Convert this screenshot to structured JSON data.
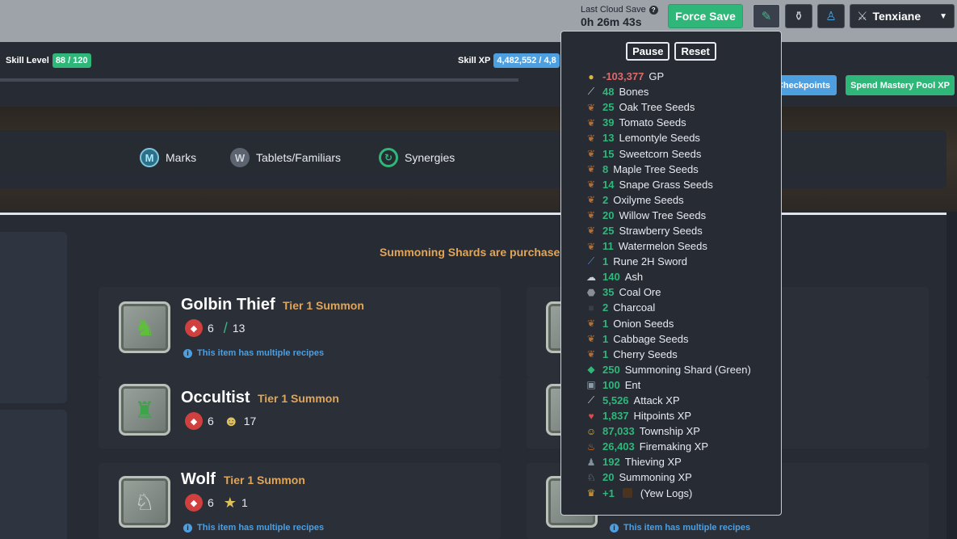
{
  "header": {
    "cloud_label": "Last Cloud Save",
    "cloud_time": "0h 26m 43s",
    "force_save": "Force Save",
    "character": "Tenxiane"
  },
  "skillbar": {
    "level_label": "Skill Level",
    "level_value": "88 / 120",
    "xp_label": "Skill XP",
    "xp_value": "4,482,552 / 4,8",
    "checkpoints": "Checkpoints",
    "spend_pool": "Spend Mastery Pool XP"
  },
  "tabs": [
    {
      "label": "Marks",
      "icon": "marks-icon"
    },
    {
      "label": "Tablets/Familiars",
      "icon": "wolf-icon"
    },
    {
      "label": "Synergies",
      "icon": "synergy-icon"
    }
  ],
  "notice": "Summoning Shards are purchase",
  "cards": [
    {
      "name": "Golbin Thief",
      "tier": "Tier 1 Summon",
      "shards": "6",
      "cost2": "13",
      "recipe": "This item has multiple recipes"
    },
    {
      "name": "Occultist",
      "tier": "Tier 1 Summon",
      "shards": "6",
      "cost2": "17"
    },
    {
      "name": "Wolf",
      "tier": "Tier 1 Summon",
      "shards": "6",
      "cost2": "1",
      "recipe": "This item has multiple recipes"
    }
  ],
  "right_recipe": "This item has multiple recipes",
  "popup": {
    "pause": "Pause",
    "reset": "Reset",
    "loot": [
      {
        "qty": "-103,377",
        "name": "GP",
        "icon": "coins-icon",
        "negative": true
      },
      {
        "qty": "48",
        "name": "Bones",
        "icon": "bones-icon"
      },
      {
        "qty": "25",
        "name": "Oak Tree Seeds",
        "icon": "seed-icon"
      },
      {
        "qty": "39",
        "name": "Tomato Seeds",
        "icon": "seed-icon"
      },
      {
        "qty": "13",
        "name": "Lemontyle Seeds",
        "icon": "seed-icon"
      },
      {
        "qty": "15",
        "name": "Sweetcorn Seeds",
        "icon": "seed-icon"
      },
      {
        "qty": "8",
        "name": "Maple Tree Seeds",
        "icon": "seed-icon"
      },
      {
        "qty": "14",
        "name": "Snape Grass Seeds",
        "icon": "seed-icon"
      },
      {
        "qty": "2",
        "name": "Oxilyme Seeds",
        "icon": "seed-icon"
      },
      {
        "qty": "20",
        "name": "Willow Tree Seeds",
        "icon": "seed-icon"
      },
      {
        "qty": "25",
        "name": "Strawberry Seeds",
        "icon": "seed-icon"
      },
      {
        "qty": "11",
        "name": "Watermelon Seeds",
        "icon": "seed-icon"
      },
      {
        "qty": "1",
        "name": "Rune 2H Sword",
        "icon": "sword-icon"
      },
      {
        "qty": "140",
        "name": "Ash",
        "icon": "ash-icon"
      },
      {
        "qty": "35",
        "name": "Coal Ore",
        "icon": "ore-icon"
      },
      {
        "qty": "2",
        "name": "Charcoal",
        "icon": "charcoal-icon"
      },
      {
        "qty": "1",
        "name": "Onion Seeds",
        "icon": "seed-icon"
      },
      {
        "qty": "1",
        "name": "Cabbage Seeds",
        "icon": "seed-icon"
      },
      {
        "qty": "1",
        "name": "Cherry Seeds",
        "icon": "seed-icon"
      },
      {
        "qty": "250",
        "name": "Summoning Shard (Green)",
        "icon": "shard-icon"
      },
      {
        "qty": "100",
        "name": "Ent",
        "icon": "tablet-icon"
      },
      {
        "qty": "5,526",
        "name": "Attack XP",
        "icon": "attack-icon"
      },
      {
        "qty": "1,837",
        "name": "Hitpoints XP",
        "icon": "heart-icon"
      },
      {
        "qty": "87,033",
        "name": "Township XP",
        "icon": "township-icon"
      },
      {
        "qty": "26,403",
        "name": "Firemaking XP",
        "icon": "fire-icon"
      },
      {
        "qty": "192",
        "name": "Thieving XP",
        "icon": "thief-icon"
      },
      {
        "qty": "20",
        "name": "Summoning XP",
        "icon": "wolf-icon"
      },
      {
        "qty": "+1",
        "name": "(Yew Logs)",
        "icon": "trophy-icon",
        "log": true
      }
    ]
  }
}
